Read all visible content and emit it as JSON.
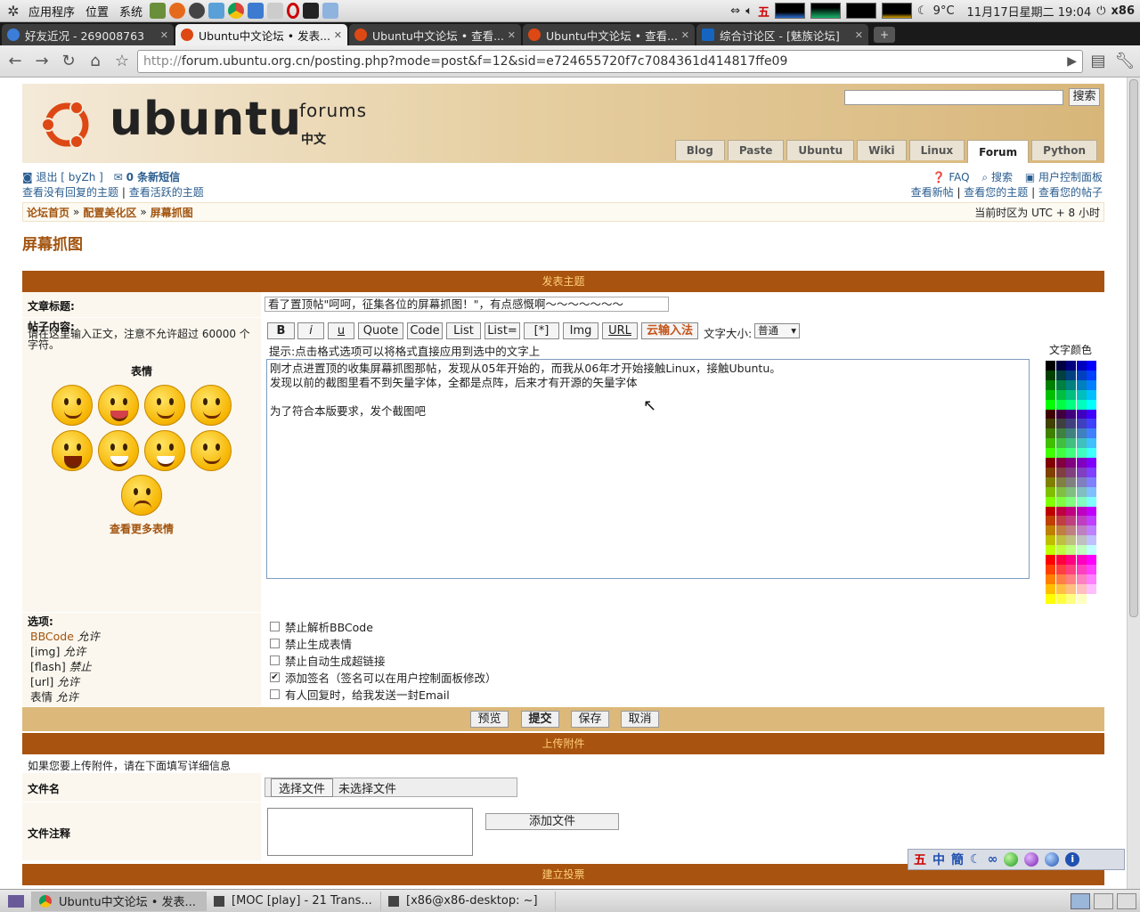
{
  "panel": {
    "menus": [
      "应用程序",
      "位置",
      "系统"
    ],
    "ime_indicator": "五",
    "weather": "9°C",
    "clock": "11月17日星期二 19:04",
    "user": "x86"
  },
  "tabs": [
    {
      "label": "好友近况 - 269008763",
      "color": "#3b7dd8"
    },
    {
      "label": "Ubuntu中文论坛 • 发表...",
      "color": "#dd4814",
      "active": true
    },
    {
      "label": "Ubuntu中文论坛 • 查看...",
      "color": "#dd4814"
    },
    {
      "label": "Ubuntu中文论坛 • 查看...",
      "color": "#dd4814"
    },
    {
      "label": "综合讨论区 - [魅族论坛]",
      "color": "#1565c0"
    }
  ],
  "address": {
    "url_prefix": "http://",
    "url_rest": "forum.ubuntu.org.cn/posting.php?mode=post&f=12&sid=e724655720f7c7084361d414817ffe09"
  },
  "header": {
    "logo_word": "ubuntu",
    "logo_forums": "forums",
    "logo_cn": "中文",
    "search_button": "搜索",
    "nav": [
      "Blog",
      "Paste",
      "Ubuntu",
      "Wiki",
      "Linux",
      "Forum",
      "Python"
    ],
    "nav_active": "Forum"
  },
  "userbar": {
    "logout": "退出 [ byZh ]",
    "messages": "0 条新短信",
    "unanswered": "查看没有回复的主题",
    "active": "查看活跃的主题",
    "faq": "FAQ",
    "search": "搜索",
    "ucp": "用户控制面板",
    "new_posts": "查看新帖",
    "your_topics": "查看您的主题",
    "your_posts": "查看您的帖子"
  },
  "breadcrumb": {
    "home": "论坛首页",
    "sep": "»",
    "cat": "配置美化区",
    "forum": "屏幕抓图",
    "timezone": "当前时区为 UTC + 8 小时"
  },
  "page_title": "屏幕抓图",
  "post": {
    "section_header": "发表主题",
    "subject_label": "文章标题:",
    "subject_value": "看了置顶帖\"呵呵，征集各位的屏幕抓图！\"，有点感慨啊～～～～～～～",
    "body_label": "帖子内容:",
    "body_hint": "请在这里输入正文，注意不允许超过 60000 个字符。",
    "emoticons_label": "表情",
    "more_emoticons": "查看更多表情",
    "format_buttons": [
      "B",
      "i",
      "u",
      "Quote",
      "Code",
      "List",
      "List=",
      "[*]",
      "Img",
      "URL",
      "云输入法"
    ],
    "font_size_label": "文字大小:",
    "font_size_value": "普通",
    "format_hint": "提示:点击格式选项可以将格式直接应用到选中的文字上",
    "text_color_label": "文字颜色",
    "content": "刚才点进置顶的收集屏幕抓图那帖，发现从05年开始的，而我从06年才开始接触Linux，接触Ubuntu。\n发现以前的截图里看不到矢量字体，全都是点阵，后来才有开源的矢量字体\n\n为了符合本版要求，发个截图吧",
    "options_label": "选项:",
    "bbcode_status": [
      {
        "name": "BBCode",
        "state": "允许"
      },
      {
        "name": "[img]",
        "state": "允许"
      },
      {
        "name": "[flash]",
        "state": "禁止"
      },
      {
        "name": "[url]",
        "state": "允许"
      },
      {
        "name": "表情",
        "state": "允许"
      }
    ],
    "options": [
      {
        "label": "禁止解析BBCode",
        "checked": false
      },
      {
        "label": "禁止生成表情",
        "checked": false
      },
      {
        "label": "禁止自动生成超链接",
        "checked": false
      },
      {
        "label": "添加签名（签名可以在用户控制面板修改）",
        "checked": true
      },
      {
        "label": "有人回复时，给我发送一封Email",
        "checked": false
      }
    ],
    "preview": "预览",
    "submit": "提交",
    "save": "保存",
    "cancel": "取消"
  },
  "attach": {
    "header": "上传附件",
    "hint": "如果您要上传附件，请在下面填写详细信息",
    "filename_label": "文件名",
    "choose_file": "选择文件",
    "no_file": "未选择文件",
    "comment_label": "文件注释",
    "add_file": "添加文件"
  },
  "poll": {
    "header": "建立投票"
  },
  "ime_bar": [
    "五",
    "中",
    "簡"
  ],
  "taskbar": [
    "Ubuntu中文论坛 • 发表...",
    "[MOC [play] - 21 Trans...",
    "[x86@x86-desktop: ~]"
  ]
}
